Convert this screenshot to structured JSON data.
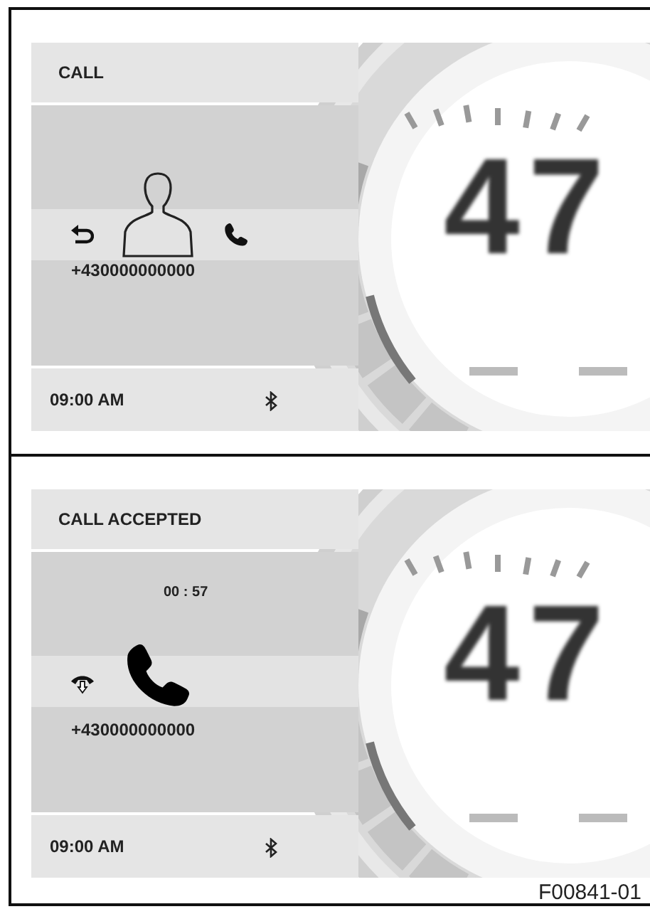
{
  "panels": [
    {
      "kind": "incoming",
      "title": "CALL",
      "number": "+430000000000",
      "time": "09:00 AM",
      "speed": "47"
    },
    {
      "kind": "accepted",
      "title": "CALL ACCEPTED",
      "duration": "00 : 57",
      "number": "+430000000000",
      "time": "09:00 AM",
      "speed": "47"
    }
  ],
  "figure_id": "F00841-01"
}
